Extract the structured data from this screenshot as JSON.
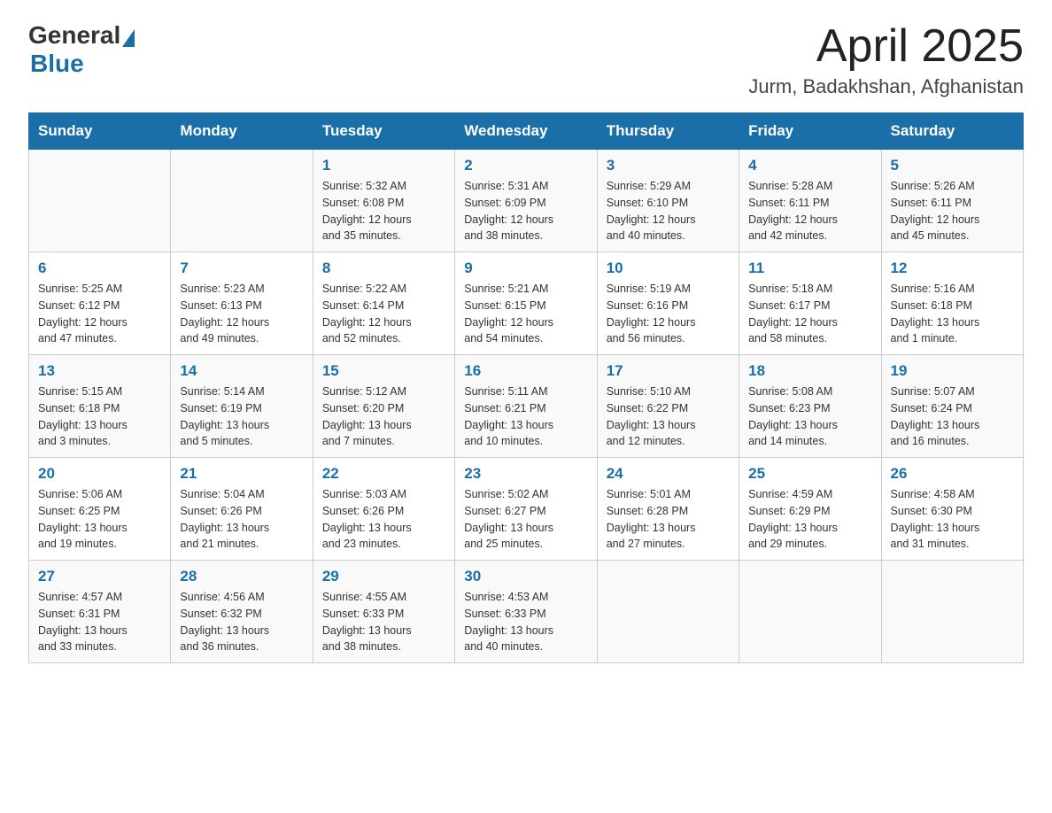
{
  "header": {
    "logo_general": "General",
    "logo_blue": "Blue",
    "month_title": "April 2025",
    "location": "Jurm, Badakhshan, Afghanistan"
  },
  "days_of_week": [
    "Sunday",
    "Monday",
    "Tuesday",
    "Wednesday",
    "Thursday",
    "Friday",
    "Saturday"
  ],
  "weeks": [
    [
      {
        "day": "",
        "info": ""
      },
      {
        "day": "",
        "info": ""
      },
      {
        "day": "1",
        "info": "Sunrise: 5:32 AM\nSunset: 6:08 PM\nDaylight: 12 hours\nand 35 minutes."
      },
      {
        "day": "2",
        "info": "Sunrise: 5:31 AM\nSunset: 6:09 PM\nDaylight: 12 hours\nand 38 minutes."
      },
      {
        "day": "3",
        "info": "Sunrise: 5:29 AM\nSunset: 6:10 PM\nDaylight: 12 hours\nand 40 minutes."
      },
      {
        "day": "4",
        "info": "Sunrise: 5:28 AM\nSunset: 6:11 PM\nDaylight: 12 hours\nand 42 minutes."
      },
      {
        "day": "5",
        "info": "Sunrise: 5:26 AM\nSunset: 6:11 PM\nDaylight: 12 hours\nand 45 minutes."
      }
    ],
    [
      {
        "day": "6",
        "info": "Sunrise: 5:25 AM\nSunset: 6:12 PM\nDaylight: 12 hours\nand 47 minutes."
      },
      {
        "day": "7",
        "info": "Sunrise: 5:23 AM\nSunset: 6:13 PM\nDaylight: 12 hours\nand 49 minutes."
      },
      {
        "day": "8",
        "info": "Sunrise: 5:22 AM\nSunset: 6:14 PM\nDaylight: 12 hours\nand 52 minutes."
      },
      {
        "day": "9",
        "info": "Sunrise: 5:21 AM\nSunset: 6:15 PM\nDaylight: 12 hours\nand 54 minutes."
      },
      {
        "day": "10",
        "info": "Sunrise: 5:19 AM\nSunset: 6:16 PM\nDaylight: 12 hours\nand 56 minutes."
      },
      {
        "day": "11",
        "info": "Sunrise: 5:18 AM\nSunset: 6:17 PM\nDaylight: 12 hours\nand 58 minutes."
      },
      {
        "day": "12",
        "info": "Sunrise: 5:16 AM\nSunset: 6:18 PM\nDaylight: 13 hours\nand 1 minute."
      }
    ],
    [
      {
        "day": "13",
        "info": "Sunrise: 5:15 AM\nSunset: 6:18 PM\nDaylight: 13 hours\nand 3 minutes."
      },
      {
        "day": "14",
        "info": "Sunrise: 5:14 AM\nSunset: 6:19 PM\nDaylight: 13 hours\nand 5 minutes."
      },
      {
        "day": "15",
        "info": "Sunrise: 5:12 AM\nSunset: 6:20 PM\nDaylight: 13 hours\nand 7 minutes."
      },
      {
        "day": "16",
        "info": "Sunrise: 5:11 AM\nSunset: 6:21 PM\nDaylight: 13 hours\nand 10 minutes."
      },
      {
        "day": "17",
        "info": "Sunrise: 5:10 AM\nSunset: 6:22 PM\nDaylight: 13 hours\nand 12 minutes."
      },
      {
        "day": "18",
        "info": "Sunrise: 5:08 AM\nSunset: 6:23 PM\nDaylight: 13 hours\nand 14 minutes."
      },
      {
        "day": "19",
        "info": "Sunrise: 5:07 AM\nSunset: 6:24 PM\nDaylight: 13 hours\nand 16 minutes."
      }
    ],
    [
      {
        "day": "20",
        "info": "Sunrise: 5:06 AM\nSunset: 6:25 PM\nDaylight: 13 hours\nand 19 minutes."
      },
      {
        "day": "21",
        "info": "Sunrise: 5:04 AM\nSunset: 6:26 PM\nDaylight: 13 hours\nand 21 minutes."
      },
      {
        "day": "22",
        "info": "Sunrise: 5:03 AM\nSunset: 6:26 PM\nDaylight: 13 hours\nand 23 minutes."
      },
      {
        "day": "23",
        "info": "Sunrise: 5:02 AM\nSunset: 6:27 PM\nDaylight: 13 hours\nand 25 minutes."
      },
      {
        "day": "24",
        "info": "Sunrise: 5:01 AM\nSunset: 6:28 PM\nDaylight: 13 hours\nand 27 minutes."
      },
      {
        "day": "25",
        "info": "Sunrise: 4:59 AM\nSunset: 6:29 PM\nDaylight: 13 hours\nand 29 minutes."
      },
      {
        "day": "26",
        "info": "Sunrise: 4:58 AM\nSunset: 6:30 PM\nDaylight: 13 hours\nand 31 minutes."
      }
    ],
    [
      {
        "day": "27",
        "info": "Sunrise: 4:57 AM\nSunset: 6:31 PM\nDaylight: 13 hours\nand 33 minutes."
      },
      {
        "day": "28",
        "info": "Sunrise: 4:56 AM\nSunset: 6:32 PM\nDaylight: 13 hours\nand 36 minutes."
      },
      {
        "day": "29",
        "info": "Sunrise: 4:55 AM\nSunset: 6:33 PM\nDaylight: 13 hours\nand 38 minutes."
      },
      {
        "day": "30",
        "info": "Sunrise: 4:53 AM\nSunset: 6:33 PM\nDaylight: 13 hours\nand 40 minutes."
      },
      {
        "day": "",
        "info": ""
      },
      {
        "day": "",
        "info": ""
      },
      {
        "day": "",
        "info": ""
      }
    ]
  ]
}
